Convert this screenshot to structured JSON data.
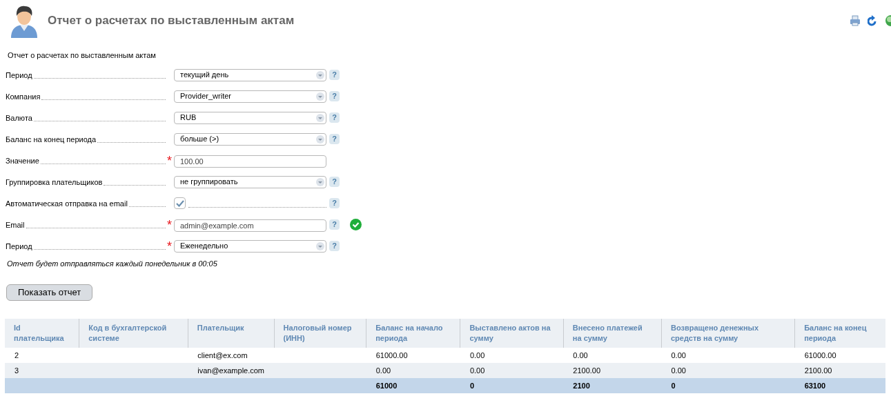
{
  "header": {
    "title": "Отчет о расчетах по выставленным актам"
  },
  "subtitle": "Отчет о расчетах по выставленным актам",
  "fields": [
    {
      "kind": "select",
      "label": "Период",
      "value": "текущий день",
      "help": "?"
    },
    {
      "kind": "select",
      "label": "Компания",
      "value": "Provider_writer",
      "help": "?"
    },
    {
      "kind": "select",
      "label": "Валюта",
      "value": "RUB",
      "help": "?"
    },
    {
      "kind": "select",
      "label": "Баланс на конец периода",
      "value": "больше (>)",
      "help": "?"
    },
    {
      "kind": "text",
      "label": "Значение",
      "value": "100.00",
      "required_mark": "*"
    },
    {
      "kind": "select",
      "label": "Группировка плательщиков",
      "value": "не группировать",
      "help": "?"
    },
    {
      "kind": "checkbox",
      "label": "Автоматическая отправка на email",
      "checked": true,
      "help": "?"
    },
    {
      "kind": "text",
      "label": "Email",
      "value": "admin@example.com",
      "required_mark": "*",
      "help": "?",
      "valid": true
    },
    {
      "kind": "select",
      "label": "Период",
      "value": "Еженедельно",
      "required_mark": "*",
      "help": "?"
    }
  ],
  "schedule_note": "Отчет будет отправляться каждый понедельник в 00:05",
  "submit_button": "Показать отчет",
  "table": {
    "columns": [
      "Id плательщика",
      "Код в бухгалтерской системе",
      "Плательщик",
      "Налоговый номер (ИНН)",
      "Баланс на начало периода",
      "Выставлено актов на сумму",
      "Внесено платежей на сумму",
      "Возвращено денежных средств на сумму",
      "Баланс на конец периода"
    ],
    "rows": [
      [
        "2",
        null,
        "client@ex.com",
        null,
        "61000.00",
        "0.00",
        "0.00",
        "0.00",
        "61000.00"
      ],
      [
        "3",
        null,
        "ivan@example.com",
        null,
        "0.00",
        "0.00",
        "2100.00",
        "0.00",
        "2100.00"
      ]
    ],
    "totals": [
      "61000",
      "0",
      "2100",
      "0",
      "63100"
    ]
  }
}
